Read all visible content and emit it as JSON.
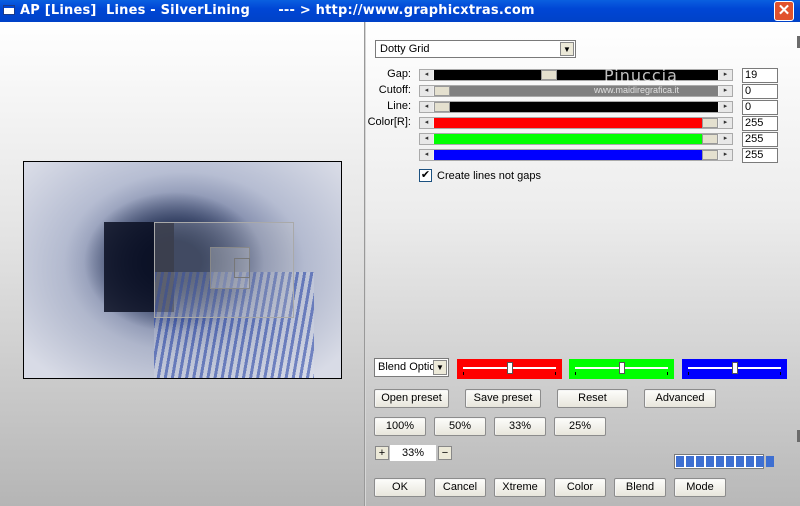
{
  "window": {
    "title": "AP [Lines]  Lines - SilverLining      --- > http://www.graphicxtras.com",
    "close_glyph": "✕"
  },
  "controls": {
    "preset": {
      "value": "Dotty Grid",
      "arrow": "▼"
    },
    "sliders": [
      {
        "label": "Gap:",
        "value": "19",
        "fill_color": "#000000",
        "thumb_fraction": 0.4
      },
      {
        "label": "Cutoff:",
        "value": "0",
        "fill_color": "#808080",
        "thumb_fraction": 0.0
      },
      {
        "label": "Line:",
        "value": "0",
        "fill_color": "#000000",
        "thumb_fraction": 0.0
      },
      {
        "label": "Color[R]:",
        "value": "255",
        "fill_color": "#ff0000",
        "thumb_fraction": 1.0
      },
      {
        "label": "",
        "value": "255",
        "fill_color": "#00ff00",
        "thumb_fraction": 1.0
      },
      {
        "label": "",
        "value": "255",
        "fill_color": "#0000ff",
        "thumb_fraction": 1.0
      }
    ],
    "slider_arrows": {
      "left": "◂",
      "right": "▸"
    },
    "checkbox": {
      "label": "Create lines not gaps",
      "checked": true,
      "glyph": "✔"
    },
    "watermark": {
      "line1": "Pinuccia",
      "line2": "www.maidiregrafica.it"
    },
    "blend": {
      "value": "Blend Optic",
      "arrow": "▼",
      "color_sliders": [
        {
          "color": "#ff0000",
          "knob_fraction": 0.5
        },
        {
          "color": "#00ff00",
          "knob_fraction": 0.5
        },
        {
          "color": "#0000ff",
          "knob_fraction": 0.5
        }
      ]
    },
    "buttons_row1": [
      "Open preset",
      "Save preset",
      "Reset",
      "Advanced"
    ],
    "zoom_buttons": [
      "100%",
      "50%",
      "33%",
      "25%"
    ],
    "zoom": {
      "plus": "+",
      "value": "33%",
      "minus": "−"
    },
    "progress_segments": 10,
    "bottom_buttons": [
      "OK",
      "Cancel",
      "Xtreme",
      "Color",
      "Blend",
      "Mode"
    ]
  }
}
